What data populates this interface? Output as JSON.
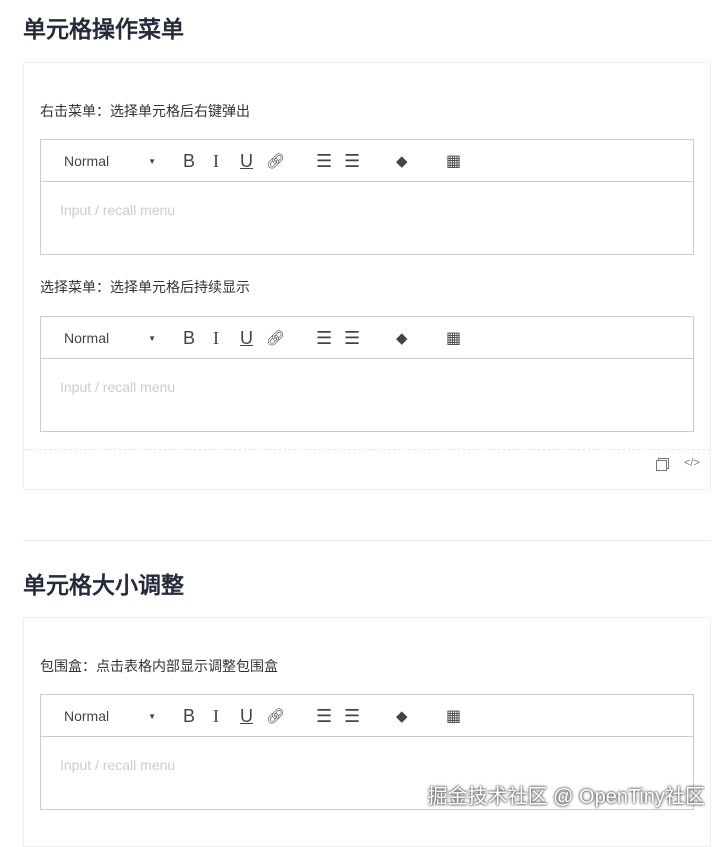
{
  "sections": [
    {
      "title": "单元格操作菜单",
      "demos": [
        {
          "label": "右击菜单：选择单元格后右键弹出",
          "placeholder": "Input / recall menu",
          "format": "Normal"
        },
        {
          "label": "选择菜单：选择单元格后持续显示",
          "placeholder": "Input / recall menu",
          "format": "Normal"
        }
      ]
    },
    {
      "title": "单元格大小调整",
      "demos": [
        {
          "label": "包围盒：点击表格内部显示调整包围盒",
          "placeholder": "Input / recall menu",
          "format": "Normal"
        }
      ]
    }
  ],
  "watermark": "掘金技术社区 @ OpenTiny社区"
}
